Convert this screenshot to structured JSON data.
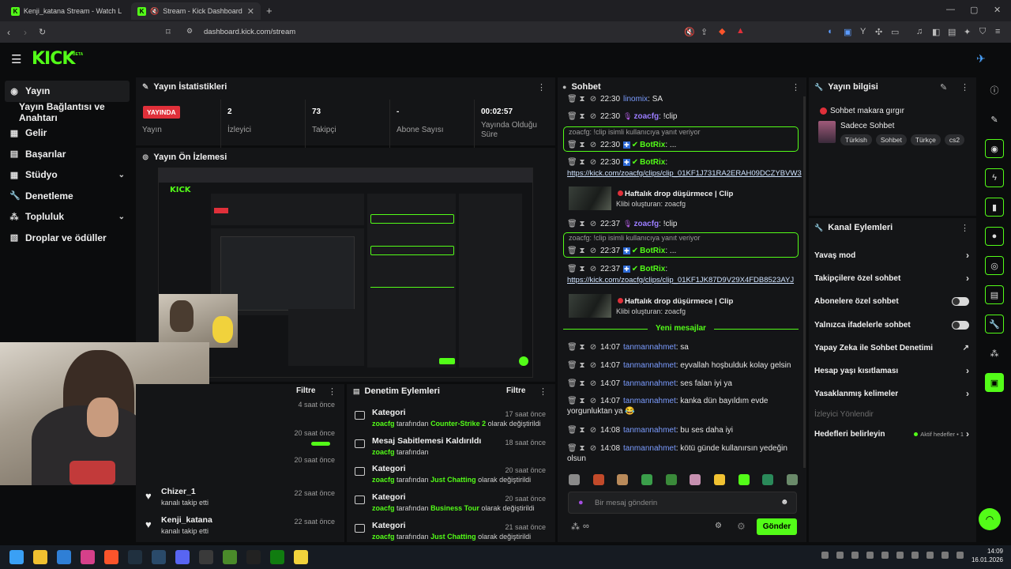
{
  "browser": {
    "tabs": [
      {
        "title": "Kenji_katana Stream - Watch Live on"
      },
      {
        "title": "Stream - Kick Dashboard"
      }
    ],
    "url": "dashboard.kick.com/stream"
  },
  "header": {
    "logo": "KICK",
    "beta": "BETA"
  },
  "sidebar": {
    "items": [
      {
        "label": "Yayın",
        "icon": "broadcast-icon",
        "chevron": false,
        "active": true
      },
      {
        "label": "Yayın Bağlantısı ve Anahtarı",
        "icon": "",
        "chevron": false
      },
      {
        "label": "Gelir",
        "icon": "revenue-icon",
        "chevron": false
      },
      {
        "label": "Başarılar",
        "icon": "trophy-icon",
        "chevron": false
      },
      {
        "label": "Stüdyo",
        "icon": "studio-icon",
        "chevron": true
      },
      {
        "label": "Denetleme",
        "icon": "wrench-icon",
        "chevron": false
      },
      {
        "label": "Topluluk",
        "icon": "community-icon",
        "chevron": true
      },
      {
        "label": "Droplar ve ödüller",
        "icon": "gift-icon",
        "chevron": false
      }
    ]
  },
  "stats": {
    "title": "Yayın İstatistikleri",
    "live_badge": "YAYINDA",
    "items": [
      {
        "value": "",
        "label": "Yayın"
      },
      {
        "value": "2",
        "label": "İzleyici"
      },
      {
        "value": "73",
        "label": "Takipçi"
      },
      {
        "value": "-",
        "label": "Abone Sayısı"
      },
      {
        "value": "00:02:57",
        "label": "Yayında Olduğu Süre"
      }
    ]
  },
  "preview": {
    "title": "Yayın Ön İzlemesi"
  },
  "activity": {
    "filter": "Filtre",
    "items": [
      {
        "time": "4 saat önce"
      },
      {
        "time": "20 saat önce"
      },
      {
        "time": "20 saat önce"
      },
      {
        "name": "Chizer_1",
        "sub": "kanalı takip etti",
        "time": "22 saat önce"
      },
      {
        "name": "Kenji_katana",
        "sub": "kanalı takip etti",
        "time": "22 saat önce"
      }
    ]
  },
  "moderation": {
    "title": "Denetim Eylemleri",
    "filter": "Filtre",
    "items": [
      {
        "title": "Kategori",
        "user": "zoacfg",
        "mid": " tarafından ",
        "value": "Counter-Strike 2",
        "suffix": " olarak değiştirildi",
        "time": "17 saat önce"
      },
      {
        "title": "Mesaj Sabitlemesi Kaldırıldı",
        "user": "zoacfg",
        "mid": " tarafından",
        "value": "",
        "suffix": "",
        "time": "18 saat önce"
      },
      {
        "title": "Kategori",
        "user": "zoacfg",
        "mid": " tarafından ",
        "value": "Just Chatting",
        "suffix": " olarak değiştirildi",
        "time": "20 saat önce"
      },
      {
        "title": "Kategori",
        "user": "zoacfg",
        "mid": " tarafından ",
        "value": "Business Tour",
        "suffix": " olarak değiştirildi",
        "time": "20 saat önce"
      },
      {
        "title": "Kategori",
        "user": "zoacfg",
        "mid": " tarafından ",
        "value": "Just Chatting",
        "suffix": " olarak değiştirildi",
        "time": "21 saat önce"
      }
    ]
  },
  "chat": {
    "title": "Sohbet",
    "messages": [
      {
        "time": "22:30",
        "user": "linomix",
        "text": ": SA"
      },
      {
        "time": "22:30",
        "user": "zoacfg",
        "text": ": !clip"
      },
      {
        "reply": "zoacfg: !clip isimli kullanıcıya yanıt veriyor",
        "time": "22:30",
        "user": "BotRix",
        "text": ": ..."
      },
      {
        "time": "22:30",
        "user": "BotRix",
        "text": ":"
      },
      {
        "link": "https://kick.com/zoacfg/clips/clip_01KF1J731RA2ERAH09DCZYBVW3"
      },
      {
        "clip_title": "Haftalık drop düşürmece | Clip",
        "clip_sub": "Klibi oluşturan: zoacfg"
      },
      {
        "time": "22:37",
        "user": "zoacfg",
        "text": ": !clip"
      },
      {
        "reply": "zoacfg: !clip isimli kullanıcıya yanıt veriyor",
        "time": "22:37",
        "user": "BotRix",
        "text": ": ..."
      },
      {
        "time": "22:37",
        "user": "BotRix",
        "text": ":"
      },
      {
        "link": "https://kick.com/zoacfg/clips/clip_01KF1JK87D9V29X4FDB8523AYJ"
      },
      {
        "clip_title": "Haftalık drop düşürmece | Clip",
        "clip_sub": "Klibi oluşturan: zoacfg"
      }
    ],
    "new_divider": "Yeni mesajlar",
    "new_messages": [
      {
        "time": "14:07",
        "user": "tanmannahmet",
        "text": ": sa"
      },
      {
        "time": "14:07",
        "user": "tanmannahmet",
        "text": ": eyvallah hoşbulduk kolay gelsin"
      },
      {
        "time": "14:07",
        "user": "tanmannahmet",
        "text": ": ses falan iyi ya"
      },
      {
        "time": "14:07",
        "user": "tanmannahmet",
        "text": ": kanka dün bayıldım evde",
        "cont": "yorgunluktan ya 😂"
      },
      {
        "time": "14:08",
        "user": "tanmannahmet",
        "text": ": bu ses daha iyi"
      },
      {
        "time": "14:08",
        "user": "tanmannahmet",
        "text": ": kötü günde kullanırsın yedeğin",
        "cont": "olsun"
      }
    ],
    "input_placeholder": "Bir mesaj gönderin",
    "send": "Gönder"
  },
  "info": {
    "title": "Yayın bilgisi",
    "stream_title": "Sohbet makara gırgır",
    "category": "Sadece Sohbet",
    "tags": [
      "Türkish",
      "Sohbet",
      "Türkçe",
      "cs2"
    ]
  },
  "channel_actions": {
    "title": "Kanal Eylemleri",
    "items": [
      {
        "label": "Yavaş mod",
        "kind": "chevron"
      },
      {
        "label": "Takipçilere özel sohbet",
        "kind": "chevron"
      },
      {
        "label": "Abonelere özel sohbet",
        "kind": "toggle"
      },
      {
        "label": "Yalnızca ifadelerle sohbet",
        "kind": "toggle"
      },
      {
        "label": "Yapay Zeka ile Sohbet Denetimi",
        "kind": "external"
      },
      {
        "label": "Hesap yaşı kısıtlaması",
        "kind": "chevron"
      },
      {
        "label": "Yasaklanmış kelimeler",
        "kind": "chevron"
      },
      {
        "label": "İzleyici Yönlendir",
        "kind": "disabled"
      },
      {
        "label": "Hedefleri belirleyin",
        "kind": "goal",
        "extra": "Aktif hedefler • 1"
      }
    ]
  },
  "taskbar": {
    "time": "14:09",
    "date": "16.01.2026"
  },
  "colors": {
    "accent": "#53fc18",
    "live": "#e0303a",
    "panel": "#141517",
    "bg": "#0b0c0d"
  }
}
